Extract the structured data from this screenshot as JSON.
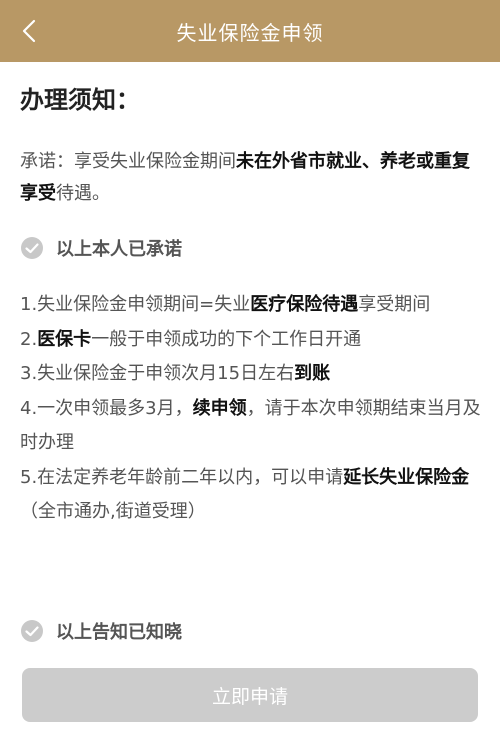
{
  "header": {
    "title": "失业保险金申领"
  },
  "section_title": "办理须知：",
  "promise": {
    "prefix": "承诺：享受失业保险金期间",
    "bold1": "未在外省市就业、养老或重复享受",
    "suffix": "待遇。"
  },
  "agree_promise": {
    "label": "以上本人已承诺",
    "checked": false
  },
  "notices": [
    {
      "prefix": "1.失业保险金申领期间=失业",
      "bold": "医疗保险待遇",
      "suffix": "享受期间"
    },
    {
      "prefix": "2.",
      "bold": "医保卡",
      "suffix": "一般于申领成功的下个工作日开通"
    },
    {
      "prefix": "3.失业保险金于申领次月15日左右",
      "bold": "到账",
      "suffix": ""
    },
    {
      "prefix": "4.一次申领最多3月，",
      "bold": "续申领",
      "suffix": "，请于本次申领期结束当月及时办理"
    },
    {
      "prefix": "5.在法定养老年龄前二年以内，可以申请",
      "bold": "延长失业保险金",
      "suffix": "（全市通办,街道受理）"
    }
  ],
  "agree_notice": {
    "label": "以上告知已知晓",
    "checked": false
  },
  "submit": {
    "label": "立即申请"
  },
  "colors": {
    "header": "#b89865",
    "check": "#c8c8c8",
    "button_disabled": "#cccccc"
  }
}
